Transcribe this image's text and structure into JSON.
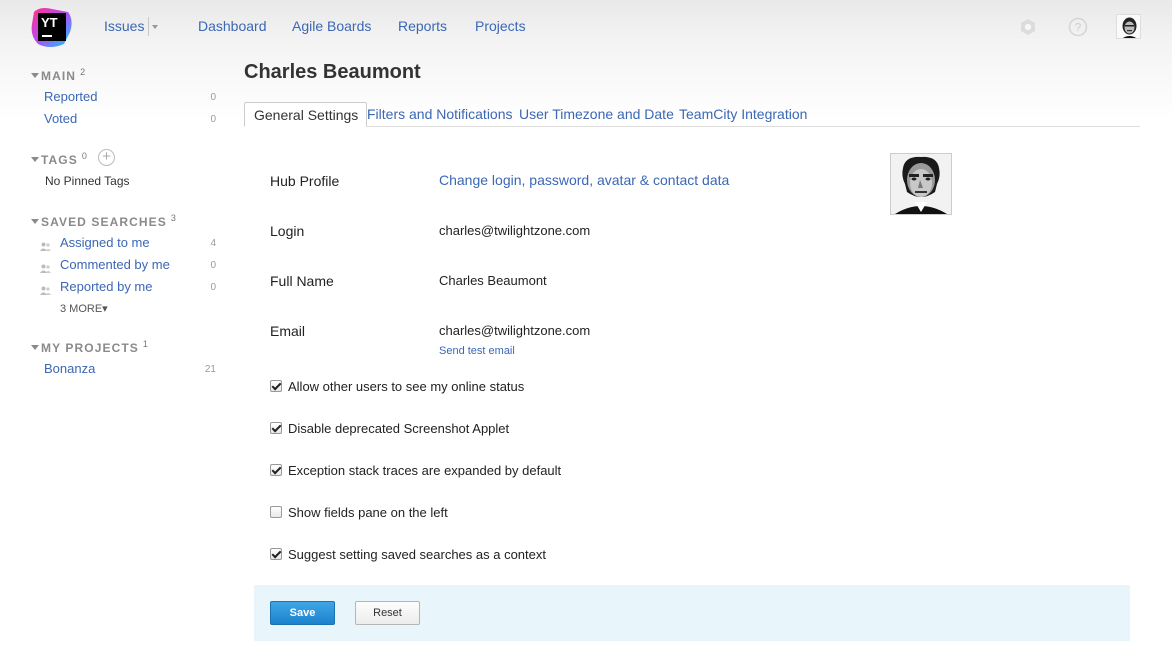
{
  "header": {
    "logo_text": "YT",
    "nav": [
      {
        "label": "Issues"
      },
      {
        "label": "Dashboard"
      },
      {
        "label": "Agile Boards"
      },
      {
        "label": "Reports"
      },
      {
        "label": "Projects"
      }
    ],
    "icons": [
      "settings-icon",
      "help-icon",
      "user-avatar"
    ]
  },
  "sidebar": {
    "main": {
      "title": "MAIN",
      "count": "2",
      "items": [
        {
          "label": "Reported",
          "count": "0"
        },
        {
          "label": "Voted",
          "count": "0"
        }
      ]
    },
    "tags": {
      "title": "TAGS",
      "count": "0",
      "empty_text": "No Pinned Tags"
    },
    "saved_searches": {
      "title": "SAVED SEARCHES",
      "count": "3",
      "items": [
        {
          "label": "Assigned to me",
          "count": "4"
        },
        {
          "label": "Commented by me",
          "count": "0"
        },
        {
          "label": "Reported by me",
          "count": "0"
        }
      ],
      "more_label": "3 MORE▾"
    },
    "projects": {
      "title": "MY PROJECTS",
      "count": "1",
      "items": [
        {
          "label": "Bonanza",
          "count": "21"
        }
      ]
    }
  },
  "main": {
    "title": "Charles Beaumont",
    "tabs": [
      {
        "label": "General Settings",
        "active": true
      },
      {
        "label": "Filters and Notifications",
        "active": false
      },
      {
        "label": "User Timezone and Date",
        "active": false
      },
      {
        "label": "TeamCity Integration",
        "active": false
      }
    ],
    "fields": {
      "hub_profile": {
        "label": "Hub Profile",
        "link": "Change login, password, avatar & contact data"
      },
      "login": {
        "label": "Login",
        "value": "charles@twilightzone.com"
      },
      "full_name": {
        "label": "Full Name",
        "value": "Charles Beaumont"
      },
      "email": {
        "label": "Email",
        "value": "charles@twilightzone.com",
        "link": "Send test email"
      }
    },
    "checkboxes": [
      {
        "label": "Allow other users to see my online status",
        "checked": true
      },
      {
        "label": "Disable deprecated Screenshot Applet",
        "checked": true
      },
      {
        "label": "Exception stack traces are expanded by default",
        "checked": true
      },
      {
        "label": "Show fields pane on the left",
        "checked": false
      },
      {
        "label": "Suggest setting saved searches as a context",
        "checked": true
      }
    ],
    "buttons": {
      "save": "Save",
      "reset": "Reset"
    }
  },
  "colors": {
    "link": "#3b67b4",
    "primary_button": "#1c82cc",
    "footer_bar": "#e8f5fb"
  }
}
